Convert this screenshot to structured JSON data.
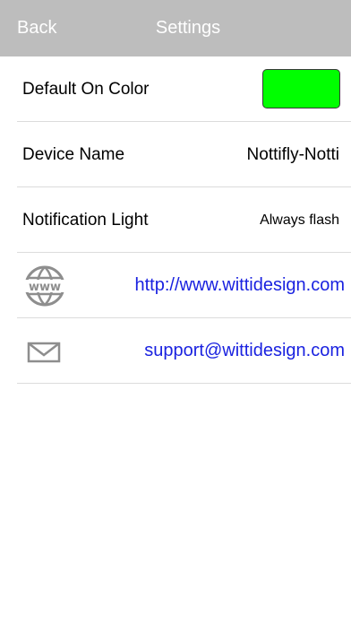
{
  "navbar": {
    "back_label": "Back",
    "title": "Settings"
  },
  "settings": {
    "default_on_color": {
      "label": "Default On Color",
      "color": "#00ff00"
    },
    "device_name": {
      "label": "Device Name",
      "value": "Nottifly-Notti"
    },
    "notification_light": {
      "label": "Notification Light",
      "value": "Always flash"
    },
    "website": {
      "icon": "globe-www-icon",
      "url": "http://www.wittidesign.com"
    },
    "email": {
      "icon": "envelope-icon",
      "address": "support@wittidesign.com"
    }
  },
  "colors": {
    "navbar_bg": "#bdbdbd",
    "link": "#1a22e0",
    "separator": "#dcdcdc"
  }
}
